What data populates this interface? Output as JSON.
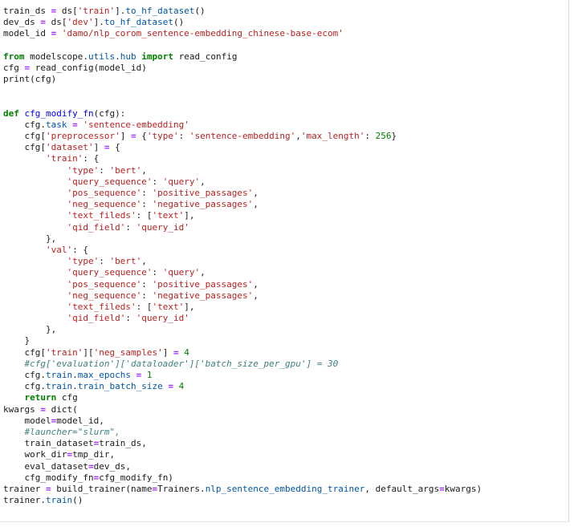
{
  "code": {
    "lines": [
      [
        [
          "ident",
          "train_ds "
        ],
        [
          "op",
          "="
        ],
        [
          "ident",
          " ds["
        ],
        [
          "str",
          "'train'"
        ],
        [
          "ident",
          "]."
        ],
        [
          "attr",
          "to_hf_dataset"
        ],
        [
          "ident",
          "()"
        ]
      ],
      [
        [
          "ident",
          "dev_ds "
        ],
        [
          "op",
          "="
        ],
        [
          "ident",
          " ds["
        ],
        [
          "str",
          "'dev'"
        ],
        [
          "ident",
          "]."
        ],
        [
          "attr",
          "to_hf_dataset"
        ],
        [
          "ident",
          "()"
        ]
      ],
      [
        [
          "ident",
          "model_id "
        ],
        [
          "op",
          "="
        ],
        [
          "ident",
          " "
        ],
        [
          "str",
          "'damo/nlp_corom_sentence-embedding_chinese-base-ecom'"
        ]
      ],
      [],
      [
        [
          "kw",
          "from"
        ],
        [
          "ident",
          " modelscope."
        ],
        [
          "attr",
          "utils"
        ],
        [
          "ident",
          "."
        ],
        [
          "attr",
          "hub"
        ],
        [
          "ident",
          " "
        ],
        [
          "kw",
          "import"
        ],
        [
          "ident",
          " read_config"
        ]
      ],
      [
        [
          "ident",
          "cfg "
        ],
        [
          "op",
          "="
        ],
        [
          "ident",
          " read_config(model_id)"
        ]
      ],
      [
        [
          "ident",
          "print(cfg)"
        ]
      ],
      [],
      [],
      [
        [
          "kw",
          "def"
        ],
        [
          "ident",
          " "
        ],
        [
          "fn",
          "cfg_modify_fn"
        ],
        [
          "ident",
          "(cfg):"
        ]
      ],
      [
        [
          "ident",
          "    cfg."
        ],
        [
          "attr",
          "task"
        ],
        [
          "ident",
          " "
        ],
        [
          "op",
          "="
        ],
        [
          "ident",
          " "
        ],
        [
          "str",
          "'sentence-embedding'"
        ]
      ],
      [
        [
          "ident",
          "    cfg["
        ],
        [
          "str",
          "'preprocessor'"
        ],
        [
          "ident",
          "] "
        ],
        [
          "op",
          "="
        ],
        [
          "ident",
          " {"
        ],
        [
          "str",
          "'type'"
        ],
        [
          "ident",
          ": "
        ],
        [
          "str",
          "'sentence-embedding'"
        ],
        [
          "ident",
          ","
        ],
        [
          "str",
          "'max_length'"
        ],
        [
          "ident",
          ": "
        ],
        [
          "num",
          "256"
        ],
        [
          "ident",
          "}"
        ]
      ],
      [
        [
          "ident",
          "    cfg["
        ],
        [
          "str",
          "'dataset'"
        ],
        [
          "ident",
          "] "
        ],
        [
          "op",
          "="
        ],
        [
          "ident",
          " {"
        ]
      ],
      [
        [
          "ident",
          "        "
        ],
        [
          "str",
          "'train'"
        ],
        [
          "ident",
          ": {"
        ]
      ],
      [
        [
          "ident",
          "            "
        ],
        [
          "str",
          "'type'"
        ],
        [
          "ident",
          ": "
        ],
        [
          "str",
          "'bert'"
        ],
        [
          "ident",
          ","
        ]
      ],
      [
        [
          "ident",
          "            "
        ],
        [
          "str",
          "'query_sequence'"
        ],
        [
          "ident",
          ": "
        ],
        [
          "str",
          "'query'"
        ],
        [
          "ident",
          ","
        ]
      ],
      [
        [
          "ident",
          "            "
        ],
        [
          "str",
          "'pos_sequence'"
        ],
        [
          "ident",
          ": "
        ],
        [
          "str",
          "'positive_passages'"
        ],
        [
          "ident",
          ","
        ]
      ],
      [
        [
          "ident",
          "            "
        ],
        [
          "str",
          "'neg_sequence'"
        ],
        [
          "ident",
          ": "
        ],
        [
          "str",
          "'negative_passages'"
        ],
        [
          "ident",
          ","
        ]
      ],
      [
        [
          "ident",
          "            "
        ],
        [
          "str",
          "'text_fileds'"
        ],
        [
          "ident",
          ": ["
        ],
        [
          "str",
          "'text'"
        ],
        [
          "ident",
          "],"
        ]
      ],
      [
        [
          "ident",
          "            "
        ],
        [
          "str",
          "'qid_field'"
        ],
        [
          "ident",
          ": "
        ],
        [
          "str",
          "'query_id'"
        ]
      ],
      [
        [
          "ident",
          "        },"
        ]
      ],
      [
        [
          "ident",
          "        "
        ],
        [
          "str",
          "'val'"
        ],
        [
          "ident",
          ": {"
        ]
      ],
      [
        [
          "ident",
          "            "
        ],
        [
          "str",
          "'type'"
        ],
        [
          "ident",
          ": "
        ],
        [
          "str",
          "'bert'"
        ],
        [
          "ident",
          ","
        ]
      ],
      [
        [
          "ident",
          "            "
        ],
        [
          "str",
          "'query_sequence'"
        ],
        [
          "ident",
          ": "
        ],
        [
          "str",
          "'query'"
        ],
        [
          "ident",
          ","
        ]
      ],
      [
        [
          "ident",
          "            "
        ],
        [
          "str",
          "'pos_sequence'"
        ],
        [
          "ident",
          ": "
        ],
        [
          "str",
          "'positive_passages'"
        ],
        [
          "ident",
          ","
        ]
      ],
      [
        [
          "ident",
          "            "
        ],
        [
          "str",
          "'neg_sequence'"
        ],
        [
          "ident",
          ": "
        ],
        [
          "str",
          "'negative_passages'"
        ],
        [
          "ident",
          ","
        ]
      ],
      [
        [
          "ident",
          "            "
        ],
        [
          "str",
          "'text_fileds'"
        ],
        [
          "ident",
          ": ["
        ],
        [
          "str",
          "'text'"
        ],
        [
          "ident",
          "],"
        ]
      ],
      [
        [
          "ident",
          "            "
        ],
        [
          "str",
          "'qid_field'"
        ],
        [
          "ident",
          ": "
        ],
        [
          "str",
          "'query_id'"
        ]
      ],
      [
        [
          "ident",
          "        },"
        ]
      ],
      [
        [
          "ident",
          "    }"
        ]
      ],
      [
        [
          "ident",
          "    cfg["
        ],
        [
          "str",
          "'train'"
        ],
        [
          "ident",
          "]["
        ],
        [
          "str",
          "'neg_samples'"
        ],
        [
          "ident",
          "] "
        ],
        [
          "op",
          "="
        ],
        [
          "ident",
          " "
        ],
        [
          "num",
          "4"
        ]
      ],
      [
        [
          "ident",
          "    "
        ],
        [
          "cm",
          "#cfg['evaluation']['dataloader']['batch_size_per_gpu'] = 30"
        ]
      ],
      [
        [
          "ident",
          "    cfg."
        ],
        [
          "attr",
          "train"
        ],
        [
          "ident",
          "."
        ],
        [
          "attr",
          "max_epochs"
        ],
        [
          "ident",
          " "
        ],
        [
          "op",
          "="
        ],
        [
          "ident",
          " "
        ],
        [
          "num",
          "1"
        ]
      ],
      [
        [
          "ident",
          "    cfg."
        ],
        [
          "attr",
          "train"
        ],
        [
          "ident",
          "."
        ],
        [
          "attr",
          "train_batch_size"
        ],
        [
          "ident",
          " "
        ],
        [
          "op",
          "="
        ],
        [
          "ident",
          " "
        ],
        [
          "num",
          "4"
        ]
      ],
      [
        [
          "ident",
          "    "
        ],
        [
          "kw",
          "return"
        ],
        [
          "ident",
          " cfg"
        ]
      ],
      [
        [
          "ident",
          "kwargs "
        ],
        [
          "op",
          "="
        ],
        [
          "ident",
          " dict("
        ]
      ],
      [
        [
          "ident",
          "    model"
        ],
        [
          "op",
          "="
        ],
        [
          "ident",
          "model_id,"
        ]
      ],
      [
        [
          "ident",
          "    "
        ],
        [
          "cm",
          "#launcher=\"slurm\","
        ]
      ],
      [
        [
          "ident",
          "    train_dataset"
        ],
        [
          "op",
          "="
        ],
        [
          "ident",
          "train_ds,"
        ]
      ],
      [
        [
          "ident",
          "    work_dir"
        ],
        [
          "op",
          "="
        ],
        [
          "ident",
          "tmp_dir,"
        ]
      ],
      [
        [
          "ident",
          "    eval_dataset"
        ],
        [
          "op",
          "="
        ],
        [
          "ident",
          "dev_ds,"
        ]
      ],
      [
        [
          "ident",
          "    cfg_modify_fn"
        ],
        [
          "op",
          "="
        ],
        [
          "ident",
          "cfg_modify_fn)"
        ]
      ],
      [
        [
          "ident",
          "trainer "
        ],
        [
          "op",
          "="
        ],
        [
          "ident",
          " build_trainer(name"
        ],
        [
          "op",
          "="
        ],
        [
          "ident",
          "Trainers."
        ],
        [
          "attr",
          "nlp_sentence_embedding_trainer"
        ],
        [
          "ident",
          ", default_args"
        ],
        [
          "op",
          "="
        ],
        [
          "ident",
          "kwargs)"
        ]
      ],
      [
        [
          "ident",
          "trainer."
        ],
        [
          "attr",
          "train"
        ],
        [
          "ident",
          "()"
        ]
      ]
    ]
  },
  "colors": {
    "keyword": "#008000",
    "string": "#ba2121",
    "number": "#008000",
    "operator": "#aa22ff",
    "attribute": "#0055aa",
    "function_name": "#0000ff",
    "comment": "#408080",
    "text": "#1a1a1a",
    "background": "#ffffff"
  }
}
